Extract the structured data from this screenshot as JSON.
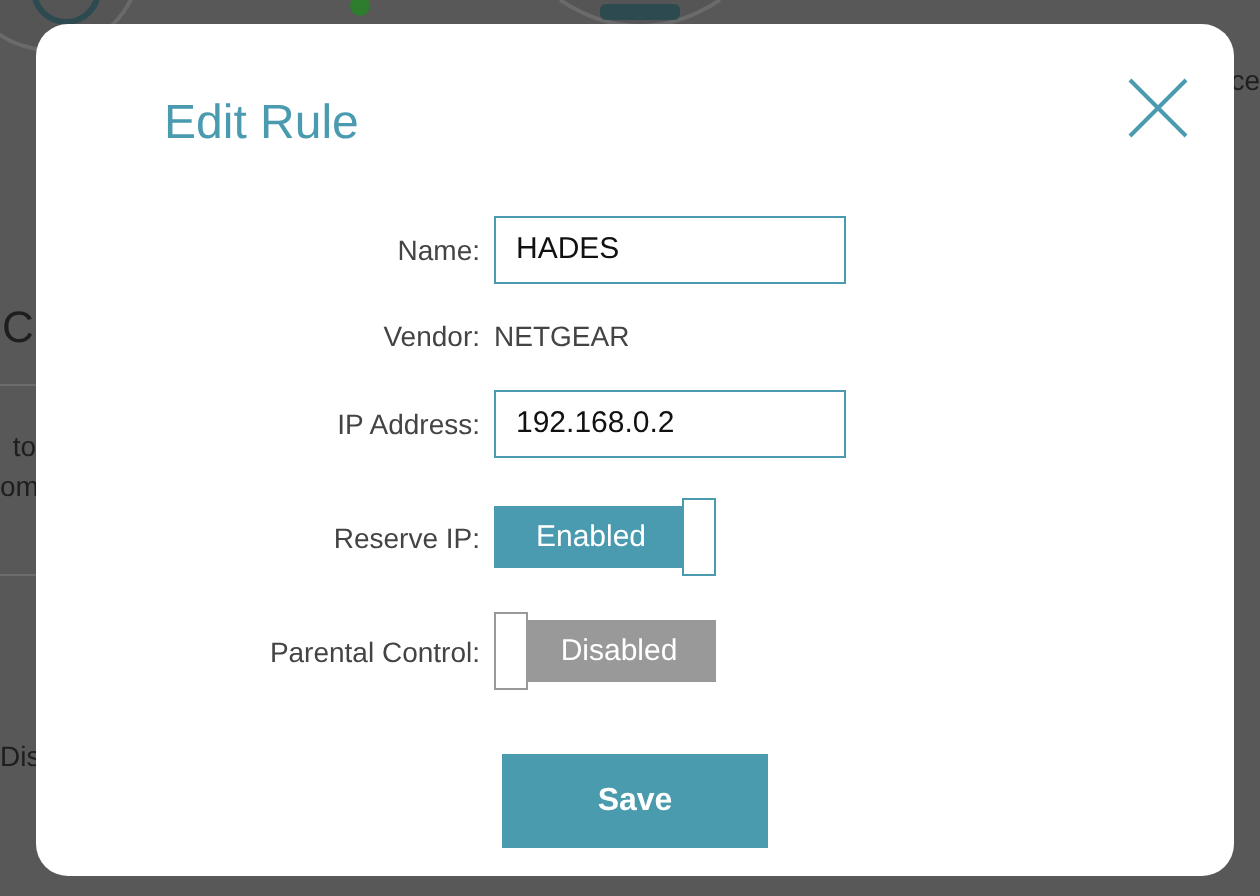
{
  "background": {
    "fragments_left": [
      "C",
      "to",
      "om",
      "Dis"
    ],
    "fragment_right": "ce"
  },
  "dialog": {
    "title": "Edit Rule",
    "fields": [
      {
        "kind": "input",
        "label": "Name:",
        "value": "HADES"
      },
      {
        "kind": "text",
        "label": "Vendor:",
        "value": "NETGEAR"
      },
      {
        "kind": "input",
        "label": "IP Address:",
        "value": "192.168.0.2"
      },
      {
        "kind": "toggle",
        "label": "Reserve IP:",
        "on": true,
        "state_text": "Enabled"
      },
      {
        "kind": "toggle",
        "label": "Parental Control:",
        "on": false,
        "state_text": "Disabled"
      }
    ],
    "save_button": "Save"
  }
}
